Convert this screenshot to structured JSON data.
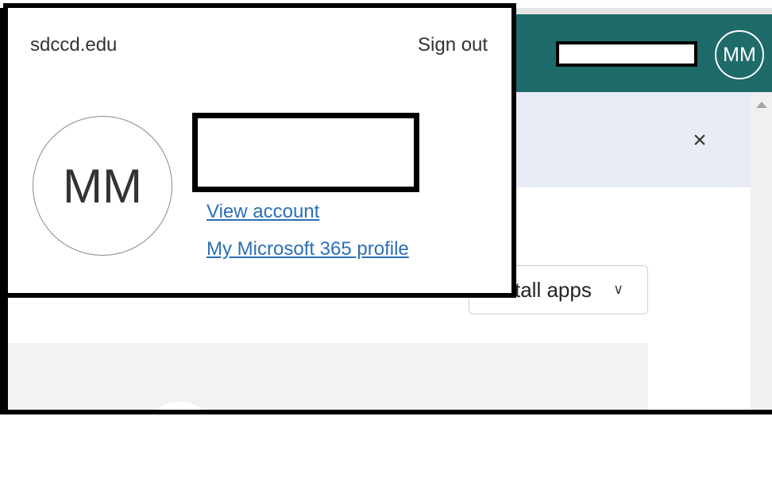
{
  "header": {
    "avatar_initials": "MM",
    "bar_color": "#1e6b69"
  },
  "banner": {
    "close_icon": "×"
  },
  "install": {
    "label": "tall apps",
    "chevron": "∨"
  },
  "account_popup": {
    "org": "sdccd.edu",
    "sign_out": "Sign out",
    "avatar_initials": "MM",
    "links": {
      "view_account": "View account",
      "profile": "My Microsoft 365 profile"
    },
    "link_color": "#2b6fb6"
  }
}
